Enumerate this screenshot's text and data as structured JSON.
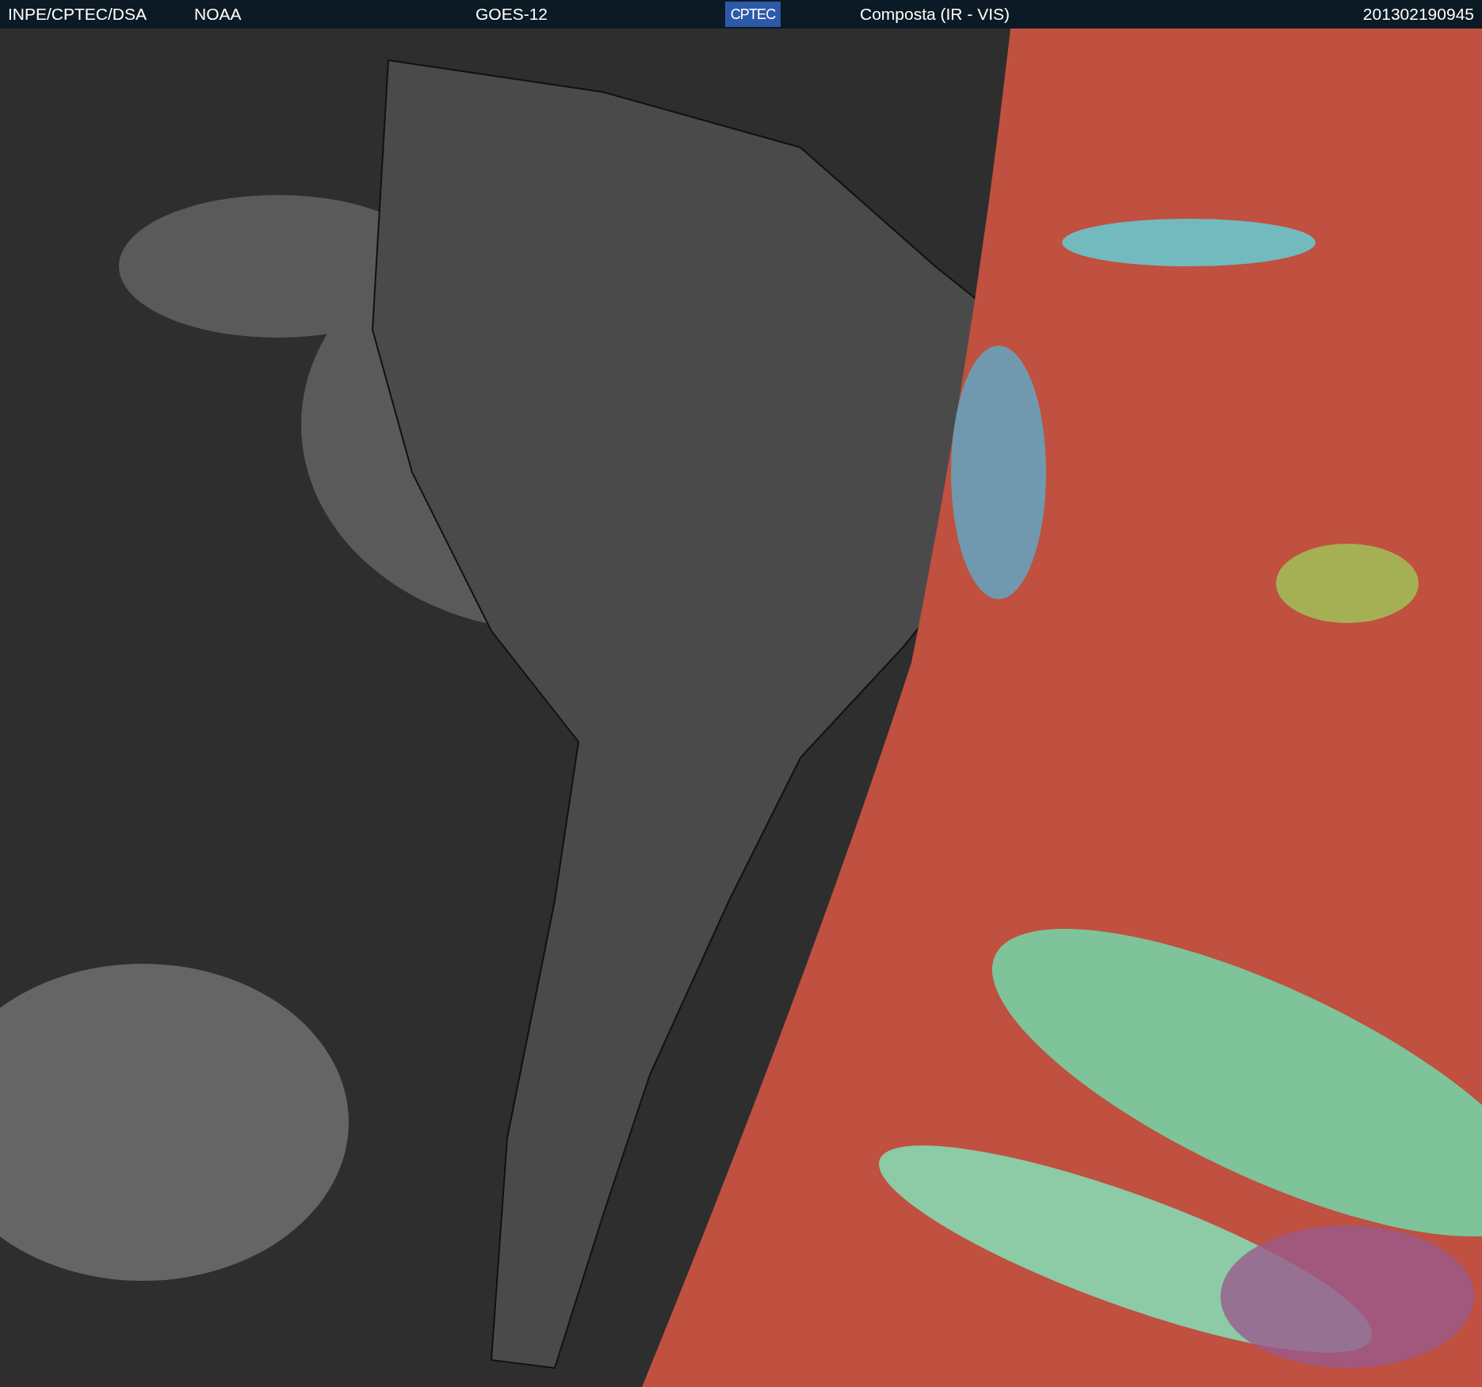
{
  "header": {
    "institution": "INPE/CPTEC/DSA",
    "agency": "NOAA",
    "satellite": "GOES-12",
    "logo": "CPTEC",
    "product": "Composta (IR - VIS)",
    "timestamp": "201302190945"
  }
}
